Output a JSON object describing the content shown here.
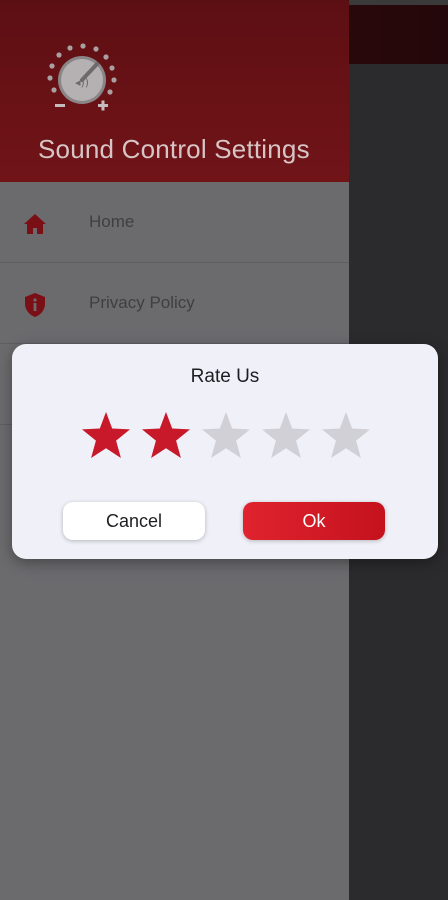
{
  "drawer": {
    "title": "Sound Control Settings",
    "items": [
      {
        "label": "Home",
        "icon": "home-icon"
      },
      {
        "label": "Privacy Policy",
        "icon": "shield-info-icon"
      }
    ]
  },
  "dialog": {
    "title": "Rate Us",
    "rating": 2,
    "max_rating": 5,
    "cancel_label": "Cancel",
    "ok_label": "Ok"
  },
  "colors": {
    "accent": "#c8192a",
    "star_filled": "#c8192a",
    "star_empty": "#d0d0d6",
    "header": "#6a1216"
  }
}
